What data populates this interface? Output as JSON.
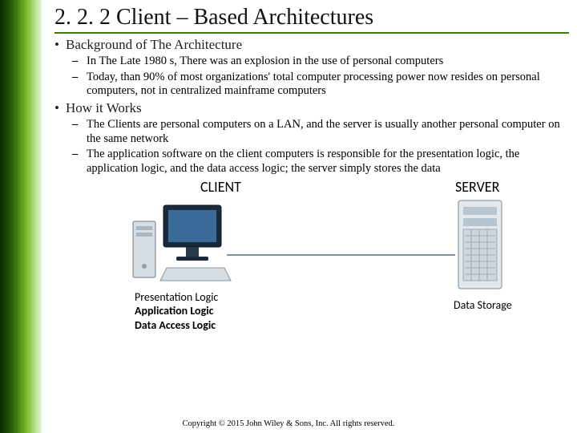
{
  "title": "2. 2. 2 Client – Based Architectures",
  "bullets": {
    "background": {
      "heading": "Background of The Architecture",
      "items": [
        " In The Late 1980 s, There was an explosion in the use of personal computers",
        " Today, than 90% of most organizations' total computer processing power now resides on personal computers, not in centralized mainframe computers"
      ]
    },
    "howitworks": {
      "heading": "How it Works",
      "items": [
        " The Clients are personal computers on a LAN, and the server is usually another personal computer on the same network",
        " The application software on the client computers is responsible for the presentation logic, the application logic, and the data access logic; the server simply stores the data"
      ]
    }
  },
  "diagram": {
    "client_label": "CLIENT",
    "server_label": "SERVER",
    "client_caption": {
      "line1": "Presentation Logic",
      "line2": "Application Logic",
      "line3": "Data Access Logic"
    },
    "server_caption": "Data Storage"
  },
  "copyright": "Copyright © 2015 John Wiley & Sons, Inc. All rights reserved."
}
